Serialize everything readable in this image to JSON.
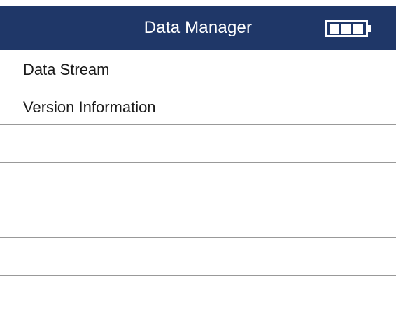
{
  "header": {
    "title": "Data Manager",
    "battery_icon": "battery-full-icon",
    "battery_level": 1.0,
    "background_color": "#1f3768"
  },
  "menu": {
    "items": [
      {
        "label": "Data Stream"
      },
      {
        "label": "Version Information"
      },
      {
        "label": ""
      },
      {
        "label": ""
      },
      {
        "label": ""
      },
      {
        "label": ""
      },
      {
        "label": ""
      }
    ]
  }
}
